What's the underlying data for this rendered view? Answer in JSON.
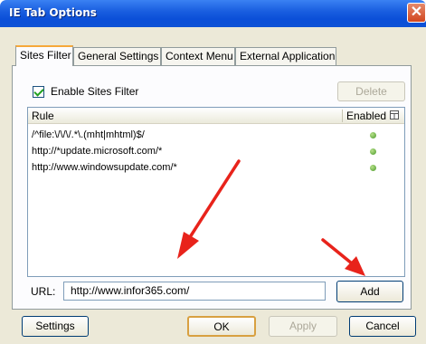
{
  "window": {
    "title": "IE Tab Options",
    "close_glyph": "✕"
  },
  "tabs": [
    {
      "label": "Sites Filter",
      "active": true
    },
    {
      "label": "General Settings",
      "active": false
    },
    {
      "label": "Context Menu",
      "active": false
    },
    {
      "label": "External Application",
      "active": false
    }
  ],
  "sites_filter": {
    "enable_label": "Enable Sites Filter",
    "enable_checked": true,
    "delete_label": "Delete",
    "columns": {
      "rule": "Rule",
      "enabled": "Enabled",
      "header_icon": "column-chooser-icon"
    },
    "rules": [
      {
        "pattern": "/^file:\\/\\/\\/.*\\.(mht|mhtml)$/",
        "enabled": true
      },
      {
        "pattern": "http://*update.microsoft.com/*",
        "enabled": true
      },
      {
        "pattern": "http://www.windowsupdate.com/*",
        "enabled": true
      }
    ],
    "url_label": "URL:",
    "url_value": "http://www.infor365.com/",
    "add_label": "Add"
  },
  "footer": {
    "settings_label": "Settings",
    "ok_label": "OK",
    "apply_label": "Apply",
    "cancel_label": "Cancel"
  },
  "colors": {
    "titlebar": "#0b4fd8",
    "arrow": "#e8231b",
    "dialog_bg": "#ece9d8"
  }
}
